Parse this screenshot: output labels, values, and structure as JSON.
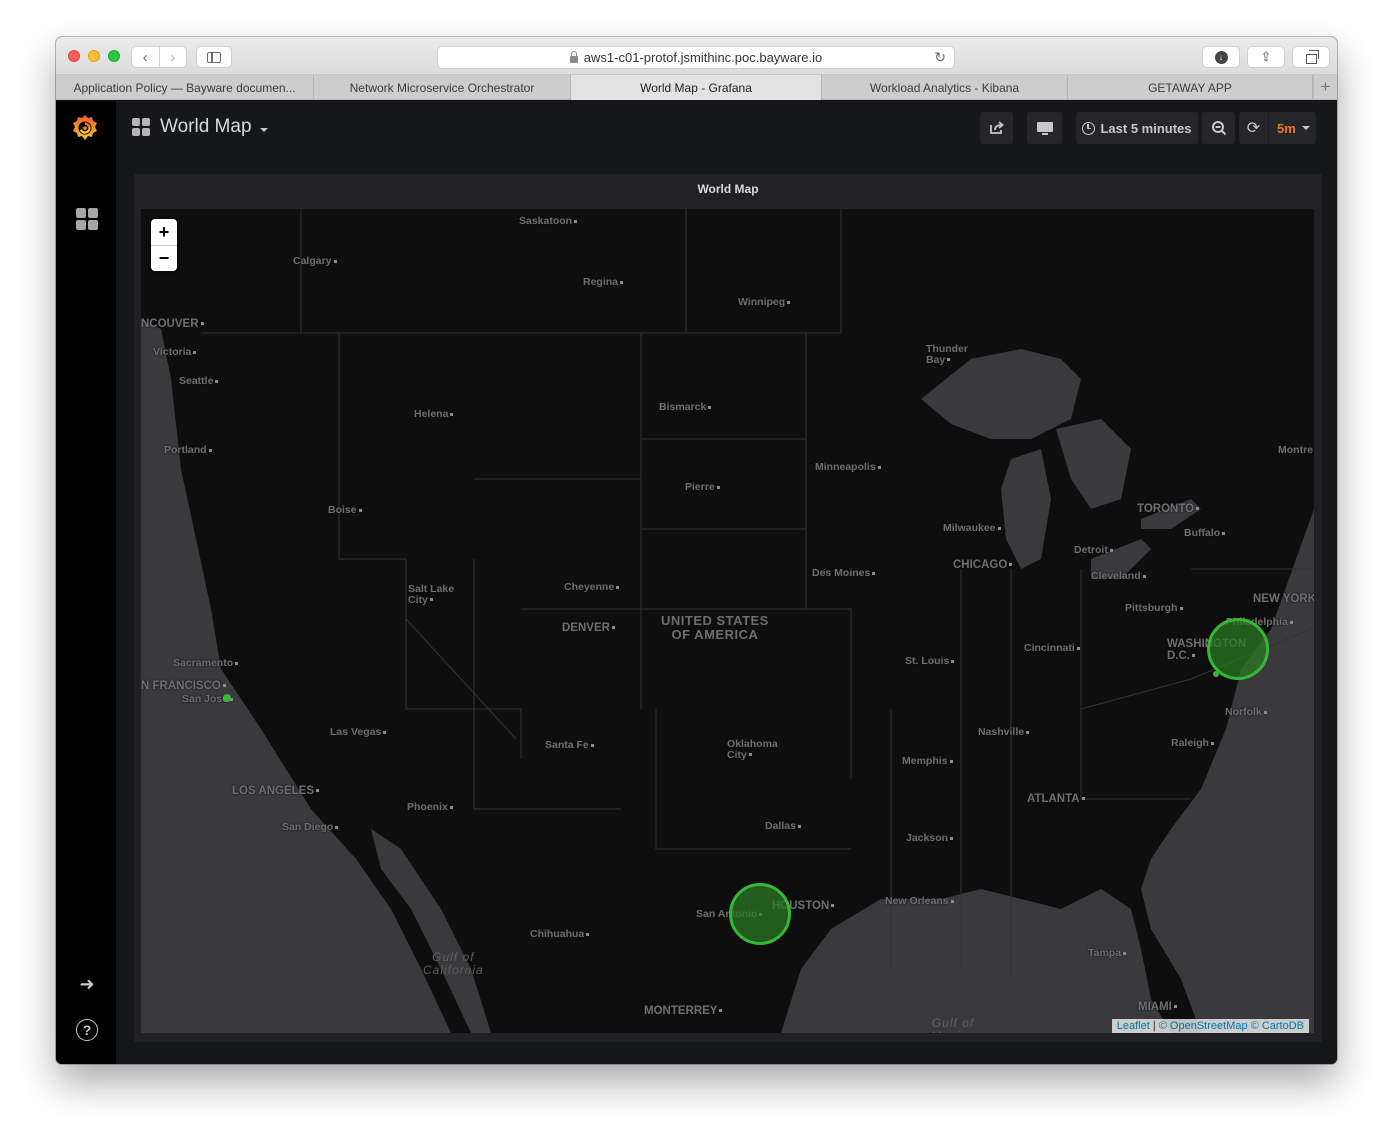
{
  "browser": {
    "url": "aws1-c01-protof.jsmithinc.poc.bayware.io",
    "tabs": [
      {
        "label": "Application Policy — Bayware documen...",
        "active": false
      },
      {
        "label": "Network Microservice Orchestrator",
        "active": false
      },
      {
        "label": "World Map - Grafana",
        "active": true
      },
      {
        "label": "Workload Analytics - Kibana",
        "active": false
      },
      {
        "label": "GETAWAY APP",
        "active": false
      }
    ],
    "new_tab_label": "+",
    "back_glyph": "‹",
    "forward_glyph": "›",
    "reload_glyph": "↻",
    "download_glyph": "↓",
    "share_glyph": "⇪"
  },
  "grafana": {
    "dashboard_title": "World Map",
    "time_range_label": "Last 5 minutes",
    "refresh_interval": "5m",
    "accent_color": "#eb7b18",
    "panel": {
      "title": "World Map",
      "zoom_in_label": "+",
      "zoom_out_label": "−",
      "attribution": {
        "leaflet": "Leaflet",
        "separator": "|",
        "osm": "© OpenStreetMap",
        "carto": "© CartoDB"
      }
    },
    "side_icons": {
      "signin_glyph": "➜",
      "help_glyph": "?"
    }
  },
  "map": {
    "country_label": "UNITED STATES\nOF AMERICA",
    "water_labels": [
      {
        "name": "gulf-of-california",
        "text": "Gulf of\nCalifornia"
      },
      {
        "name": "gulf-of-mexico",
        "text": "Gulf of\nMexico"
      }
    ],
    "cities": [
      {
        "text": "Saskatoon",
        "big": false
      },
      {
        "text": "Calgary",
        "big": false
      },
      {
        "text": "Regina",
        "big": false
      },
      {
        "text": "Winnipeg",
        "big": false
      },
      {
        "text": "NCOUVER",
        "big": true
      },
      {
        "text": "Victoria",
        "big": false
      },
      {
        "text": "Seattle",
        "big": false
      },
      {
        "text": "Thunder\nBay",
        "big": false
      },
      {
        "text": "Helena",
        "big": false
      },
      {
        "text": "Bismarck",
        "big": false
      },
      {
        "text": "Portland",
        "big": false
      },
      {
        "text": "Minneapolis",
        "big": false
      },
      {
        "text": "Montre",
        "big": false
      },
      {
        "text": "Pierre",
        "big": false
      },
      {
        "text": "TORONTO",
        "big": true
      },
      {
        "text": "Boise",
        "big": false
      },
      {
        "text": "Milwaukee",
        "big": false
      },
      {
        "text": "Buffalo",
        "big": false
      },
      {
        "text": "Detroit",
        "big": false
      },
      {
        "text": "CHICAGO",
        "big": true
      },
      {
        "text": "Des Moines",
        "big": false
      },
      {
        "text": "Cleveland",
        "big": false
      },
      {
        "text": "Cheyenne",
        "big": false
      },
      {
        "text": "Salt Lake\nCity",
        "big": false
      },
      {
        "text": "NEW YORK",
        "big": true
      },
      {
        "text": "Pittsburgh",
        "big": false
      },
      {
        "text": "Philadelphia",
        "big": false
      },
      {
        "text": "DENVER",
        "big": true
      },
      {
        "text": "Cincinnati",
        "big": false
      },
      {
        "text": "WASHINGTON\nD.C.",
        "big": true
      },
      {
        "text": "St. Louis",
        "big": false
      },
      {
        "text": "Sacramento",
        "big": false
      },
      {
        "text": "N FRANCISCO",
        "big": true
      },
      {
        "text": "San Jose",
        "big": false
      },
      {
        "text": "Norfolk",
        "big": false
      },
      {
        "text": "Nashville",
        "big": false
      },
      {
        "text": "Las Vegas",
        "big": false
      },
      {
        "text": "Santa Fe",
        "big": false
      },
      {
        "text": "Oklahoma\nCity",
        "big": false
      },
      {
        "text": "Raleigh",
        "big": false
      },
      {
        "text": "Memphis",
        "big": false
      },
      {
        "text": "LOS ANGELES",
        "big": true
      },
      {
        "text": "ATLANTA",
        "big": true
      },
      {
        "text": "Phoenix",
        "big": false
      },
      {
        "text": "Dallas",
        "big": false
      },
      {
        "text": "San Diego",
        "big": false
      },
      {
        "text": "Jackson",
        "big": false
      },
      {
        "text": "New Orleans",
        "big": false
      },
      {
        "text": "HOUSTON",
        "big": true
      },
      {
        "text": "San Antonio",
        "big": false
      },
      {
        "text": "Chihuahua",
        "big": false
      },
      {
        "text": "Tampa",
        "big": false
      },
      {
        "text": "MIAMI",
        "big": true
      },
      {
        "text": "MONTERREY",
        "big": true
      }
    ],
    "markers": [
      {
        "name": "marker-washington-dc",
        "location": "Washington D.C.",
        "size": "large",
        "color": "#37b834"
      },
      {
        "name": "marker-san-antonio",
        "location": "San Antonio",
        "size": "large",
        "color": "#37b834"
      },
      {
        "name": "marker-san-jose",
        "location": "San Jose",
        "size": "small",
        "color": "#37b834"
      },
      {
        "name": "marker-dc-small",
        "location": "Washington D.C. (west)",
        "size": "small",
        "color": "#37b834"
      }
    ]
  }
}
